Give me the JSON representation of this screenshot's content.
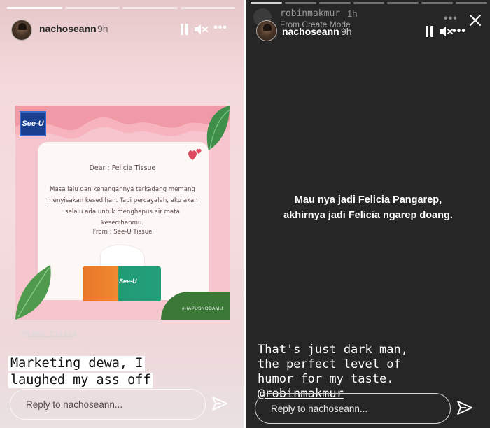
{
  "left_story": {
    "progress_segments": 4,
    "progress_done": 1,
    "username": "nachoseann",
    "time": "9h",
    "sticker_mention": "@seeu_tissue",
    "caption_lines": [
      "Marketing dewa, I",
      "laughed my ass off"
    ],
    "reply_placeholder": "Reply to nachoseann...",
    "card": {
      "brand": "See-U",
      "dear_line": "Dear : Felicia Tissue",
      "body": "Masa lalu dan kenangannya terkadang memang menyisakan kesedihan. Tapi percayalah, aku akan selalu ada untuk menghapus air mata kesedihanmu.",
      "from_line": "From : See-U  Tissue",
      "box_label": "See-U",
      "hashtag": "#HAPUSNODAMU"
    },
    "colors": {
      "card_pink": "#f6c5cd",
      "leaf_green": "#3b7a36"
    }
  },
  "right_story": {
    "progress_segments": 7,
    "progress_done": 1,
    "ghost_username": "robinmakmur",
    "ghost_time": "1h",
    "ghost_subtitle": "From Create Mode",
    "username": "nachoseann",
    "time": "9h",
    "center_text": "Mau nya jadi Felicia Pangarep, akhirnya jadi Felicia ngarep doang.",
    "caption_lines": [
      "That's just dark man,",
      "the perfect level of",
      "humor for my taste."
    ],
    "mention": "@robinmakmur",
    "reply_placeholder": "Reply to nachoseann...",
    "colors": {
      "background": "#262626"
    }
  },
  "icons": [
    "pause-icon",
    "mute-icon",
    "more-icon",
    "close-icon",
    "send-icon",
    "heart-icon"
  ]
}
